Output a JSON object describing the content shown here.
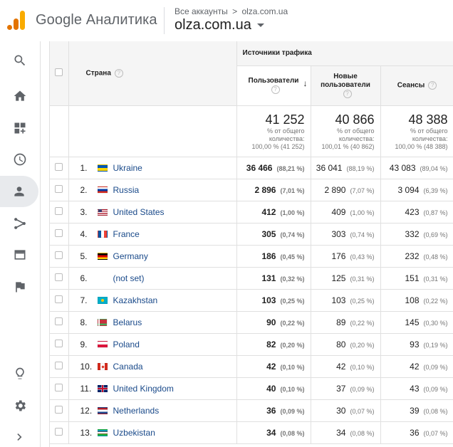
{
  "header": {
    "product_name": "Google Аналитика",
    "breadcrumb_all": "Все аккаунты",
    "breadcrumb_sep": ">",
    "breadcrumb_property": "olza.com.ua",
    "account_name": "olza.com.ua"
  },
  "sidenav": {
    "items": [
      {
        "name": "search-icon",
        "active": false
      },
      {
        "name": "home-icon",
        "active": false
      },
      {
        "name": "customization-icon",
        "active": false
      },
      {
        "name": "realtime-clock-icon",
        "active": false
      },
      {
        "name": "audience-person-icon",
        "active": true
      },
      {
        "name": "acquisition-icon",
        "active": false
      },
      {
        "name": "behavior-icon",
        "active": false
      },
      {
        "name": "conversions-flag-icon",
        "active": false
      },
      {
        "name": "discover-lightbulb-icon",
        "active": false
      },
      {
        "name": "admin-gear-icon",
        "active": false
      },
      {
        "name": "expand-chevron-icon",
        "active": false
      }
    ]
  },
  "table": {
    "col_country": "Страна",
    "group_label": "Источники трафика",
    "col_users": "Пользователи",
    "col_new_users": "Новые пользователи",
    "col_sessions": "Сеансы",
    "help_glyph": "?",
    "sort_glyph": "↓",
    "totals": {
      "users": {
        "value": "41 252",
        "line1": "% от общего",
        "line2": "количества:",
        "line3": "100,00 % (41 252)"
      },
      "new_users": {
        "value": "40 866",
        "line1": "% от общего",
        "line2": "количества:",
        "line3": "100,01 % (40 862)"
      },
      "sessions": {
        "value": "48 388",
        "line1": "% от общего",
        "line2": "количества:",
        "line3": "100,00 % (48 388)"
      }
    },
    "rows": [
      {
        "rank": "1.",
        "country": "Ukraine",
        "flag": "ua",
        "users": "36 466",
        "users_pct": "(88,21 %)",
        "new": "36 041",
        "new_pct": "(88,19 %)",
        "sess": "43 083",
        "sess_pct": "(89,04 %)"
      },
      {
        "rank": "2.",
        "country": "Russia",
        "flag": "ru",
        "users": "2 896",
        "users_pct": "(7,01 %)",
        "new": "2 890",
        "new_pct": "(7,07 %)",
        "sess": "3 094",
        "sess_pct": "(6,39 %)"
      },
      {
        "rank": "3.",
        "country": "United States",
        "flag": "us",
        "users": "412",
        "users_pct": "(1,00 %)",
        "new": "409",
        "new_pct": "(1,00 %)",
        "sess": "423",
        "sess_pct": "(0,87 %)"
      },
      {
        "rank": "4.",
        "country": "France",
        "flag": "fr",
        "users": "305",
        "users_pct": "(0,74 %)",
        "new": "303",
        "new_pct": "(0,74 %)",
        "sess": "332",
        "sess_pct": "(0,69 %)"
      },
      {
        "rank": "5.",
        "country": "Germany",
        "flag": "de",
        "users": "186",
        "users_pct": "(0,45 %)",
        "new": "176",
        "new_pct": "(0,43 %)",
        "sess": "232",
        "sess_pct": "(0,48 %)"
      },
      {
        "rank": "6.",
        "country": "(not set)",
        "flag": "",
        "users": "131",
        "users_pct": "(0,32 %)",
        "new": "125",
        "new_pct": "(0,31 %)",
        "sess": "151",
        "sess_pct": "(0,31 %)"
      },
      {
        "rank": "7.",
        "country": "Kazakhstan",
        "flag": "kz",
        "users": "103",
        "users_pct": "(0,25 %)",
        "new": "103",
        "new_pct": "(0,25 %)",
        "sess": "108",
        "sess_pct": "(0,22 %)"
      },
      {
        "rank": "8.",
        "country": "Belarus",
        "flag": "by",
        "users": "90",
        "users_pct": "(0,22 %)",
        "new": "89",
        "new_pct": "(0,22 %)",
        "sess": "145",
        "sess_pct": "(0,30 %)"
      },
      {
        "rank": "9.",
        "country": "Poland",
        "flag": "pl",
        "users": "82",
        "users_pct": "(0,20 %)",
        "new": "80",
        "new_pct": "(0,20 %)",
        "sess": "93",
        "sess_pct": "(0,19 %)"
      },
      {
        "rank": "10.",
        "country": "Canada",
        "flag": "ca",
        "users": "42",
        "users_pct": "(0,10 %)",
        "new": "42",
        "new_pct": "(0,10 %)",
        "sess": "42",
        "sess_pct": "(0,09 %)"
      },
      {
        "rank": "11.",
        "country": "United Kingdom",
        "flag": "gb",
        "users": "40",
        "users_pct": "(0,10 %)",
        "new": "37",
        "new_pct": "(0,09 %)",
        "sess": "43",
        "sess_pct": "(0,09 %)"
      },
      {
        "rank": "12.",
        "country": "Netherlands",
        "flag": "nl",
        "users": "36",
        "users_pct": "(0,09 %)",
        "new": "30",
        "new_pct": "(0,07 %)",
        "sess": "39",
        "sess_pct": "(0,08 %)"
      },
      {
        "rank": "13.",
        "country": "Uzbekistan",
        "flag": "uz",
        "users": "34",
        "users_pct": "(0,08 %)",
        "new": "34",
        "new_pct": "(0,08 %)",
        "sess": "36",
        "sess_pct": "(0,07 %)"
      }
    ]
  },
  "colors": {
    "link": "#1a4a8a",
    "header_bg": "#f5f5f5",
    "logo_orange": "#e37400",
    "logo_yellow": "#f9ab00"
  }
}
